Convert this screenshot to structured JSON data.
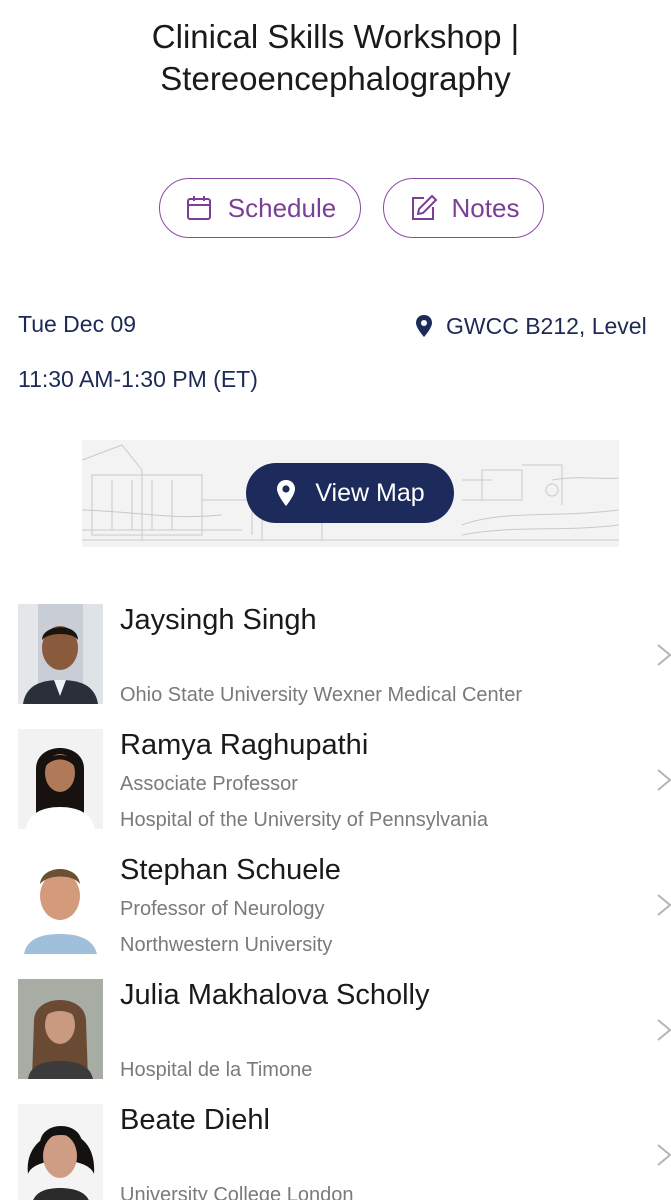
{
  "session": {
    "title_line1": "Clinical Skills Workshop |",
    "title_line2": "Stereoencephalography"
  },
  "actions": {
    "schedule_label": "Schedule",
    "notes_label": "Notes"
  },
  "details": {
    "date": "Tue Dec 09",
    "time": "11:30 AM-1:30 PM (ET)",
    "location": "GWCC B212, Level"
  },
  "map": {
    "button_label": "View Map"
  },
  "speakers": [
    {
      "name": "Jaysingh Singh",
      "role": "",
      "institution": "Ohio State University Wexner Medical Center"
    },
    {
      "name": "Ramya Raghupathi",
      "role": "Associate Professor",
      "institution": "Hospital of the University of Pennsylvania"
    },
    {
      "name": "Stephan Schuele",
      "role": "Professor of Neurology",
      "institution": "Northwestern University"
    },
    {
      "name": "Julia Makhalova Scholly",
      "role": "",
      "institution": "Hospital de la Timone"
    },
    {
      "name": "Beate Diehl",
      "role": "",
      "institution": "University College London"
    }
  ],
  "colors": {
    "accent_purple": "#8b4aa6",
    "navy": "#1c2a5c",
    "secondary_text": "#7a7a7a"
  },
  "icons": {
    "schedule": "calendar-icon",
    "notes": "edit-icon",
    "location": "map-pin-icon",
    "row": "chevron-right-icon"
  }
}
